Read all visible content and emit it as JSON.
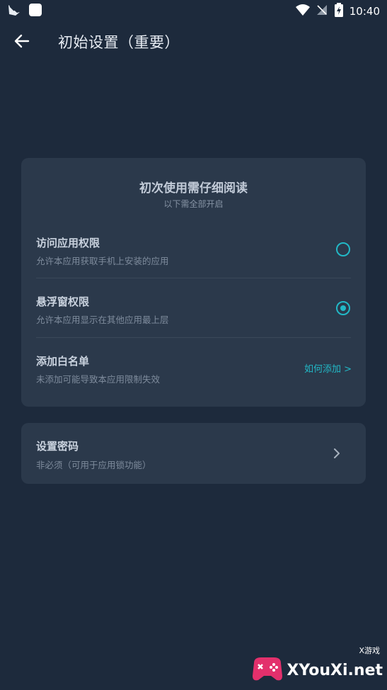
{
  "status_bar": {
    "time": "10:40"
  },
  "header": {
    "title": "初始设置（重要）"
  },
  "permissions_card": {
    "title": "初次使用需仔细阅读",
    "subtitle": "以下需全部开启",
    "items": [
      {
        "title": "访问应用权限",
        "desc": "允许本应用获取手机上安装的应用",
        "checked": false
      },
      {
        "title": "悬浮窗权限",
        "desc": "允许本应用显示在其他应用最上层",
        "checked": true
      },
      {
        "title": "添加白名单",
        "desc": "未添加可能导致本应用限制失效",
        "link": "如何添加 >"
      }
    ]
  },
  "password_card": {
    "title": "设置密码",
    "desc": "非必须（可用于应用锁功能）"
  },
  "watermark": {
    "text": "XYouXi.net",
    "small": "X游戏"
  },
  "colors": {
    "background": "#1d2a3c",
    "card": "#2b394b",
    "accent": "#22b8c6"
  }
}
